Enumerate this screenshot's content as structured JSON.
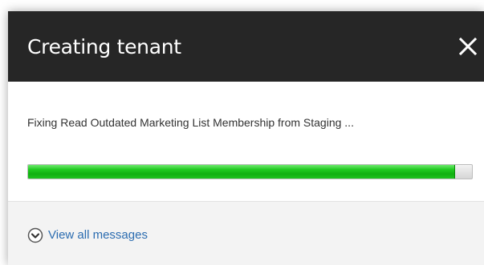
{
  "dialog": {
    "title": "Creating tenant",
    "close_icon": "close-icon",
    "status_text": "Fixing Read Outdated Marketing List Membership from Staging ...",
    "progress": 0.96,
    "progress_color": "#1fca1f",
    "view_all_label": "View all messages",
    "view_all_icon": "chevron-down-circle-icon",
    "link_color": "#2b6cb0"
  }
}
